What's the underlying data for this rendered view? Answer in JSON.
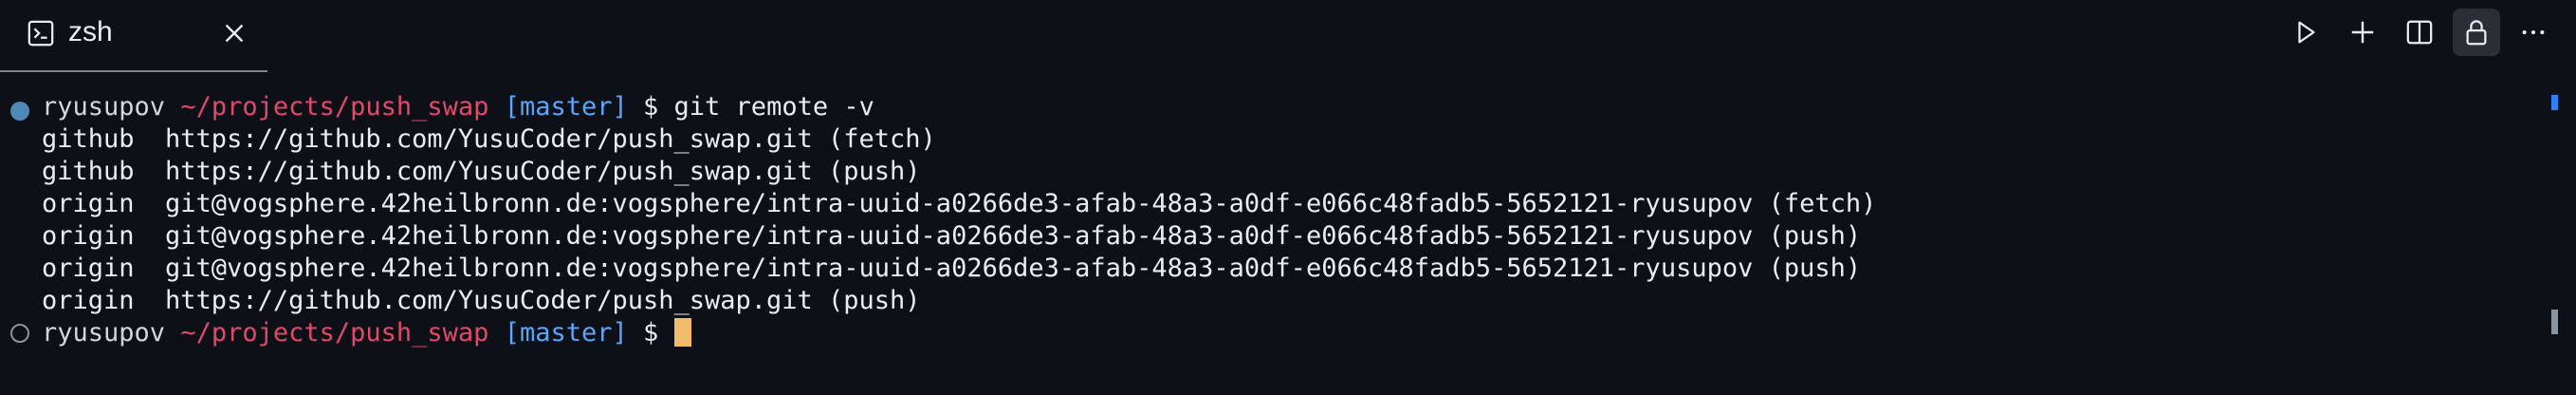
{
  "tab": {
    "title": "zsh",
    "icon": "terminal-icon",
    "close_icon": "close-icon"
  },
  "actions": [
    {
      "name": "run-button",
      "icon": "play-icon"
    },
    {
      "name": "new-terminal-button",
      "icon": "plus-icon"
    },
    {
      "name": "split-terminal-button",
      "icon": "split-icon"
    },
    {
      "name": "lock-button",
      "icon": "lock-icon"
    },
    {
      "name": "more-button",
      "icon": "ellipsis-icon"
    }
  ],
  "prompt": {
    "user": "ryusupov",
    "path": "~/projects/push_swap",
    "branch": "[master]",
    "symbol": "$"
  },
  "command": "git remote -v",
  "output": [
    "github  https://github.com/YusuCoder/push_swap.git (fetch)",
    "github  https://github.com/YusuCoder/push_swap.git (push)",
    "origin  git@vogsphere.42heilbronn.de:vogsphere/intra-uuid-a0266de3-afab-48a3-a0df-e066c48fadb5-5652121-ryusupov (fetch)",
    "origin  git@vogsphere.42heilbronn.de:vogsphere/intra-uuid-a0266de3-afab-48a3-a0df-e066c48fadb5-5652121-ryusupov (push)",
    "origin  git@vogsphere.42heilbronn.de:vogsphere/intra-uuid-a0266de3-afab-48a3-a0df-e066c48fadb5-5652121-ryusupov (push)",
    "origin  https://github.com/YusuCoder/push_swap.git (push)"
  ],
  "colors": {
    "background": "#0d1117",
    "path": "#e5476a",
    "branch": "#58a6ff",
    "cursor": "#f0bc6a",
    "dot_success": "#4d8ab8"
  }
}
